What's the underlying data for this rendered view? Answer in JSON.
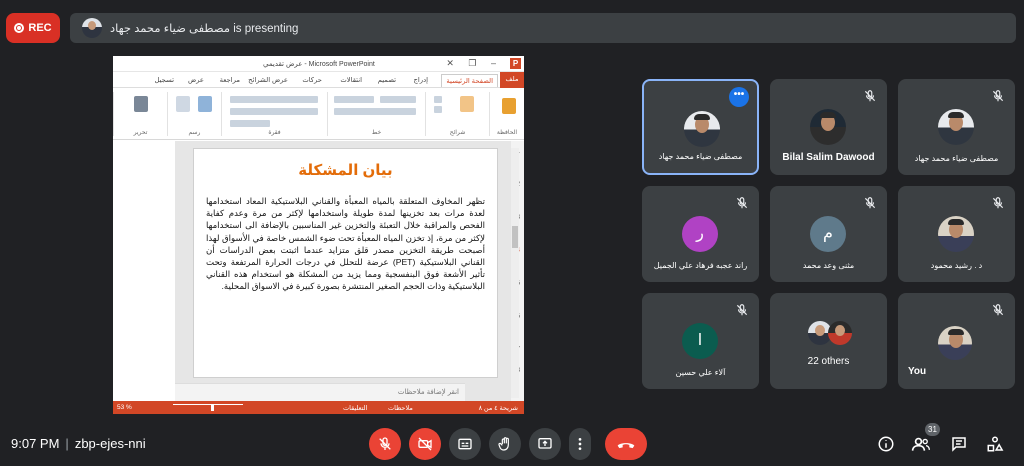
{
  "recording": {
    "label": "REC"
  },
  "presenting": {
    "text": "مصطفى ضياء محمد جهاد is presenting"
  },
  "powerpoint": {
    "window_title": "عرض تقديمي - Microsoft PowerPoint",
    "tabs": [
      "ملف",
      "الصفحة الرئيسية",
      "إدراج",
      "تصميم",
      "انتقالات",
      "حركات",
      "عرض الشرائح",
      "مراجعة",
      "عرض",
      "تسجيل"
    ],
    "ribbon_groups": [
      "الحافظة",
      "شرائح",
      "خط",
      "فقرة",
      "رسم",
      "تحرير"
    ],
    "slide_title": "بيان المشكلة",
    "slide_body": "تظهر المخاوف المتعلقة بالمياه المعبأة والقناني البلاستيكية المعاد استخدامها لعدة مرات بعد تخزينها لمدة طويلة واستخدامها لإكثر من مرة وعدم كفاية الفحص والمراقبة خلال التعبئة والتخزين غير المناسبين بالإضافة الى استخدامها لإكثر من مرة، إذ تخزن المياه المعبأة تحت ضوء الشمس خاصة في الأسواق لهذا أصبحت طريقة التخزين مصدر قلق متزايد عندما اثبتت بعض الدراسات أن القناني البلاستيكية (PET) عرضة للتحلل في درجات الحرارة المرتفعة وتحت تأثير الأشعة فوق البنفسجية ومما يزيد من المشكلة هو استخدام هذه القناني البلاستيكية وذات الحجم الصغير المنتشرة بصورة كبيرة في الاسواق المحلية.",
    "notes_placeholder": "انقر لإضافة ملاحظات",
    "slide_numbers": [
      "1",
      "2",
      "3",
      "4",
      "5",
      "6",
      "7",
      "8"
    ],
    "active_slide": 4,
    "status_slide": "شريحة ٤ من ٨",
    "status_notes": "ملاحظات",
    "status_comments": "التعليقات",
    "zoom": "53 %"
  },
  "participants": [
    {
      "name": "مصطفى ضياء محمد جهاد",
      "kind": "photo",
      "speaking": true
    },
    {
      "name": "Bilal Salim Dawood",
      "kind": "photo",
      "muted": true
    },
    {
      "name": "مصطفى ضياء محمد جهاد",
      "kind": "photo",
      "muted": true
    },
    {
      "name": "راند عجبه فرهاد علي الجميل",
      "kind": "letter",
      "letter": "ر",
      "color": "#b042c4",
      "muted": true
    },
    {
      "name": "مثنى وعد محمد",
      "kind": "letter",
      "letter": "م",
      "color": "#5f7a8b",
      "muted": true
    },
    {
      "name": "د . رشيد محمود",
      "kind": "photo",
      "muted": true
    },
    {
      "name": "آلاء علي حسين",
      "kind": "letter",
      "letter": "ا",
      "color": "#0b5c4f",
      "muted": true
    },
    {
      "name": "22 others",
      "kind": "group"
    },
    {
      "name": "You",
      "kind": "photo",
      "muted": true
    }
  ],
  "meeting": {
    "time": "9:07 PM",
    "code": "zbp-ejes-nni"
  },
  "people_count": "31"
}
